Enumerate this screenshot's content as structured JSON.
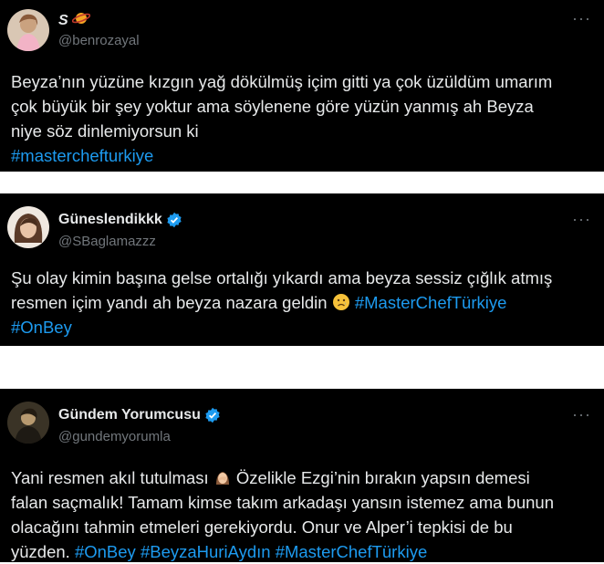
{
  "tweets": [
    {
      "display_name": "S",
      "handle": "@benrozayal",
      "verified": false,
      "lines": [
        "Beyza’nın yüzüne kızgın yağ dökülmüş içim gitti ya çok üzüldüm umarım",
        "çok büyük bir şey yoktur ama söylenene göre yüzün yanmış ah Beyza",
        "niye söz dinlemiyorsun ki"
      ],
      "hashtags_line": "#masterchefturkiye"
    },
    {
      "display_name": "Güneslendikkk",
      "handle": "@SBaglamazzz",
      "verified": true,
      "lines": [
        "Şu olay kimin başına gelse ortalığı yıkardı ama beyza sessiz çığlık atmış",
        "resmen içim yandı ah beyza nazara geldin"
      ],
      "inline_hashtag": "#MasterChefTürkiye",
      "hashtags_line": "#OnBey"
    },
    {
      "display_name": "Gündem Yorumcusu",
      "handle": "@gundemyorumla",
      "verified": true,
      "line1_a": "Yani resmen akıl tutulması",
      "line1_b": "Özelikle Ezgi’nin bırakın yapsın demesi",
      "lines": [
        "falan saçmalık! Tamam kimse takım arkadaşı yansın istemez ama bunun",
        "olacağını tahmin etmeleri gerekiyordu. Onur ve Alper’i tepkisi de bu"
      ],
      "last_line_text": "yüzden.",
      "hashtags": [
        "#OnBey",
        "#BeyzaHuriAydın",
        "#MasterChefTürkiye"
      ]
    }
  ],
  "more_label": "···",
  "colors": {
    "background": "#000000",
    "text": "#e7e9ea",
    "muted": "#71767b",
    "link": "#1d9bf0"
  }
}
